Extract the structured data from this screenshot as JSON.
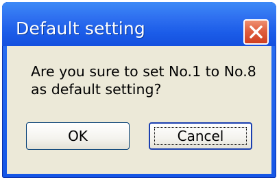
{
  "dialog": {
    "title": "Default setting",
    "message_line1": "Are you sure to set No.1 to No.8",
    "message_line2": "as default setting?",
    "ok_label": "OK",
    "cancel_label": "Cancel",
    "close_icon": "close-icon",
    "colors": {
      "titlebar": "#2f70f0",
      "close_button": "#e06040",
      "client_background": "#ece9d8"
    }
  }
}
